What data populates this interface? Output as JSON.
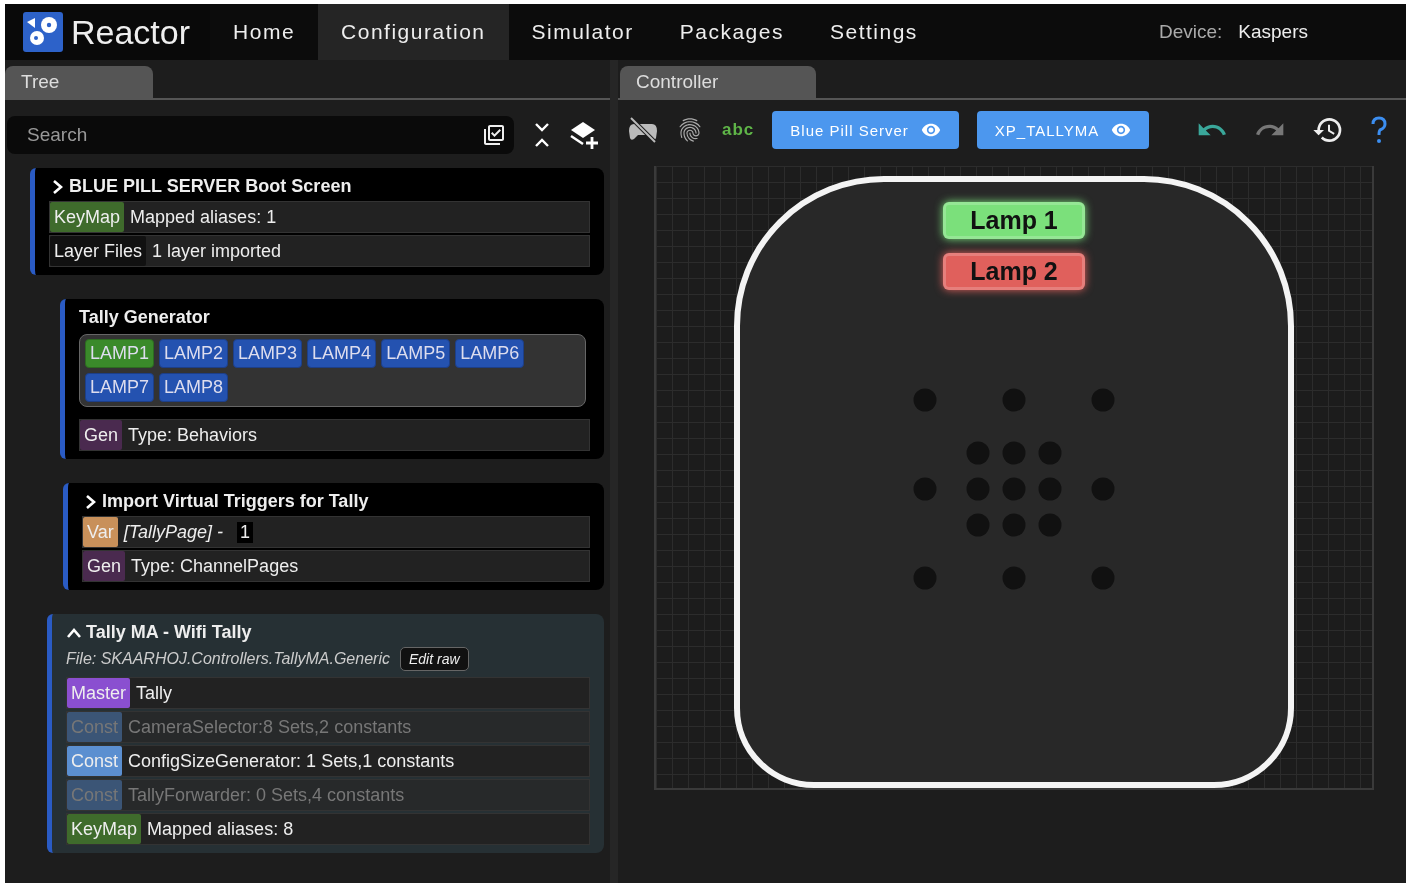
{
  "nav": {
    "brand": "Reactor",
    "tabs": [
      {
        "label": "Home",
        "selected": false
      },
      {
        "label": "Configuration",
        "selected": true
      },
      {
        "label": "Simulator",
        "selected": false
      },
      {
        "label": "Packages",
        "selected": false
      },
      {
        "label": "Settings",
        "selected": false
      }
    ],
    "device_label": "Device:",
    "device_name": "Kaspers"
  },
  "tree": {
    "tab": "Tree",
    "search": {
      "placeholder": "Search"
    },
    "nodes": [
      {
        "kind": "section",
        "title": "BLUE PILL SERVER Boot Screen",
        "expanded": false,
        "highlighted": false,
        "rows": [
          {
            "kind": "tag",
            "tag": "KeyMap",
            "color": "#3f6b2c",
            "text": "Mapped aliases: 1",
            "disabled": false
          },
          {
            "kind": "tag",
            "tag": "Layer Files",
            "color": "#111111",
            "text": "1 layer imported",
            "disabled": false
          }
        ]
      },
      {
        "kind": "generator",
        "title": "Tally Generator",
        "lamps": [
          {
            "label": "LAMP1",
            "active": true
          },
          {
            "label": "LAMP2",
            "active": false
          },
          {
            "label": "LAMP3",
            "active": false
          },
          {
            "label": "LAMP4",
            "active": false
          },
          {
            "label": "LAMP5",
            "active": false
          },
          {
            "label": "LAMP6",
            "active": false
          },
          {
            "label": "LAMP7",
            "active": false
          },
          {
            "label": "LAMP8",
            "active": false
          }
        ],
        "rows": [
          {
            "kind": "tag",
            "tag": "Gen",
            "color": "#4a2a4f",
            "text": "Type: Behaviors",
            "disabled": false
          }
        ]
      },
      {
        "kind": "section",
        "title": "Import Virtual Triggers for Tally",
        "expanded": false,
        "highlighted": false,
        "rows": [
          {
            "kind": "variable",
            "tag": "Var",
            "color": "#c8905a",
            "text": "[TallyPage] -",
            "value": "1",
            "disabled": false
          },
          {
            "kind": "tag",
            "tag": "Gen",
            "color": "#4a2a4f",
            "text": "Type: ChannelPages",
            "disabled": false
          }
        ]
      },
      {
        "kind": "section",
        "title": "Tally MA - Wifi Tally",
        "expanded": true,
        "highlighted": true,
        "file": "File: SKAARHOJ.Controllers.TallyMA.Generic",
        "edit_button": "Edit raw",
        "rows": [
          {
            "kind": "tag",
            "tag": "Master",
            "color": "#8a4fd0",
            "text": "Tally",
            "disabled": false
          },
          {
            "kind": "tag",
            "tag": "Const",
            "color": "#3b5576",
            "text": "CameraSelector:8 Sets,2 constants",
            "disabled": true
          },
          {
            "kind": "tag",
            "tag": "Const",
            "color": "#5b8fd0",
            "text": "ConfigSizeGenerator: 1 Sets,1 constants",
            "disabled": false
          },
          {
            "kind": "tag",
            "tag": "Const",
            "color": "#3b5576",
            "text": "TallyForwarder:  0 Sets,4 constants",
            "disabled": true
          },
          {
            "kind": "tag",
            "tag": "KeyMap",
            "color": "#3f6b2c",
            "text": "Mapped aliases: 8",
            "disabled": false
          }
        ]
      }
    ]
  },
  "controller": {
    "tab": "Controller",
    "text_toggle": "abc",
    "panels": [
      {
        "label": "Blue Pill Server"
      },
      {
        "label": "XP_TALLYMA"
      }
    ],
    "lamps": [
      {
        "label": "Lamp 1",
        "color": "#7be07b"
      },
      {
        "label": "Lamp 2",
        "color": "#e0605c"
      }
    ]
  }
}
